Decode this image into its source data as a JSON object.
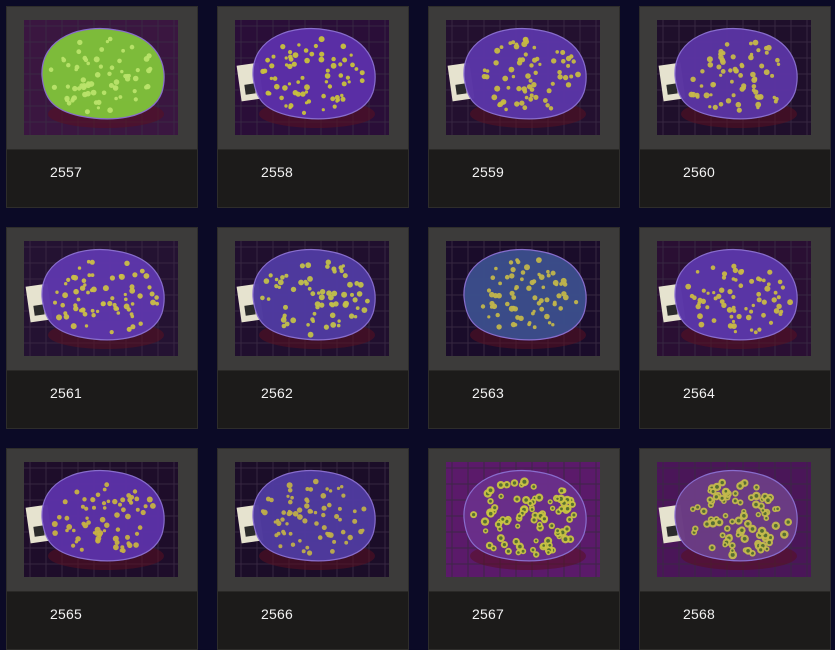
{
  "gallery": {
    "items": [
      {
        "id": "2557",
        "coral": "green-coral-icon",
        "base": "#7fbf3a",
        "spots": "#b9e36a",
        "tank": "#3a1640",
        "tag": false
      },
      {
        "id": "2558",
        "coral": "purple-coral-icon",
        "base": "#5b2fa8",
        "spots": "#c9c23c",
        "tank": "#2a0e38",
        "tag": true
      },
      {
        "id": "2559",
        "coral": "purple-coral-icon",
        "base": "#5a35a6",
        "spots": "#c7bb43",
        "tank": "#23102f",
        "tag": true
      },
      {
        "id": "2560",
        "coral": "purple-coral-icon",
        "base": "#5a34a2",
        "spots": "#c6b84a",
        "tank": "#1f0f2b",
        "tag": true
      },
      {
        "id": "2561",
        "coral": "purple-coral-icon",
        "base": "#5d36aa",
        "spots": "#cbbf47",
        "tank": "#241232",
        "tag": true
      },
      {
        "id": "2562",
        "coral": "purple-coral-icon",
        "base": "#4f3aa0",
        "spots": "#c2c04a",
        "tank": "#200f2e",
        "tag": true
      },
      {
        "id": "2563",
        "coral": "blue-coral-icon",
        "base": "#3b4d8a",
        "spots": "#c1b54b",
        "tank": "#1a0c2a",
        "tag": false
      },
      {
        "id": "2564",
        "coral": "purple-coral-icon",
        "base": "#5a36a8",
        "spots": "#c9b945",
        "tank": "#2a0f33",
        "tag": true
      },
      {
        "id": "2565",
        "coral": "purple-coral-icon",
        "base": "#5b31a6",
        "spots": "#c8b243",
        "tank": "#1e0d2a",
        "tag": true
      },
      {
        "id": "2566",
        "coral": "purple-coral-icon",
        "base": "#4f3a9e",
        "spots": "#bfae4a",
        "tank": "#1b0d28",
        "tag": true
      },
      {
        "id": "2567",
        "coral": "zoa-coral-icon",
        "base": "#6a2f8a",
        "spots": "#c9c442",
        "tank": "#5b1a6a",
        "tag": false
      },
      {
        "id": "2568",
        "coral": "zoa-coral-icon",
        "base": "#6b3c84",
        "spots": "#c4bb4c",
        "tank": "#4a1658",
        "tag": true
      }
    ]
  }
}
